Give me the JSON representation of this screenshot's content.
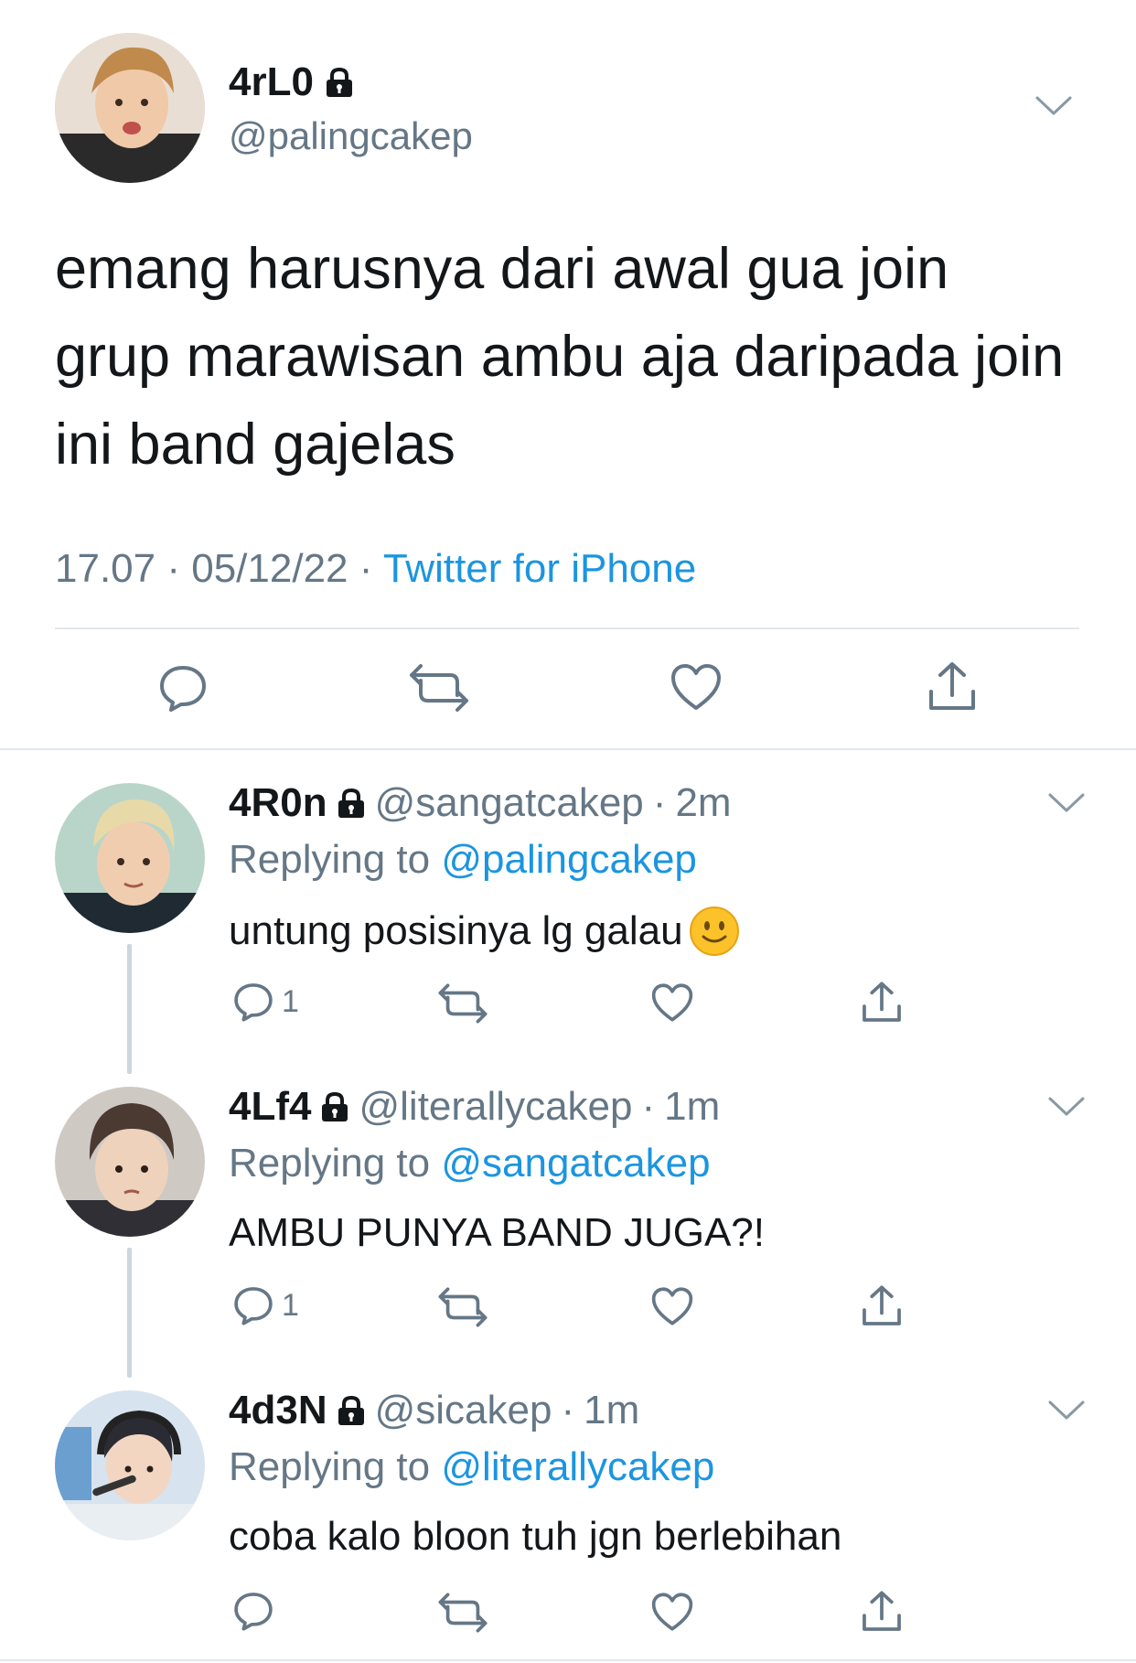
{
  "main_tweet": {
    "display_name": "4rL0",
    "handle": "@palingcakep",
    "lock_icon": "lock-icon",
    "text": "emang harusnya dari awal gua join grup marawisan ambu aja daripada join ini band gajelas",
    "time": "17.07",
    "date": "05/12/22",
    "separator": "·",
    "source": "Twitter for iPhone"
  },
  "replies": [
    {
      "display_name": "4R0n",
      "handle": "@sangatcakep",
      "age": "2m",
      "replying_label": "Replying to",
      "replying_to": "@palingcakep",
      "text": "untung posisinya lg galau",
      "emoji": "slightly-smiling-face-emoji",
      "reply_count": "1"
    },
    {
      "display_name": "4Lf4",
      "handle": "@literallycakep",
      "age": "1m",
      "replying_label": "Replying to",
      "replying_to": "@sangatcakep",
      "text": "AMBU PUNYA BAND JUGA?!",
      "reply_count": "1"
    },
    {
      "display_name": "4d3N",
      "handle": "@sicakep",
      "age": "1m",
      "replying_label": "Replying to",
      "replying_to": "@literallycakep",
      "text": "coba kalo bloon tuh jgn berlebihan",
      "reply_count": ""
    }
  ],
  "colors": {
    "text": "#14171a",
    "secondary": "#657786",
    "link": "#1b95e0",
    "divider": "#e1e8ed",
    "thread_line": "#ccd6dd"
  }
}
